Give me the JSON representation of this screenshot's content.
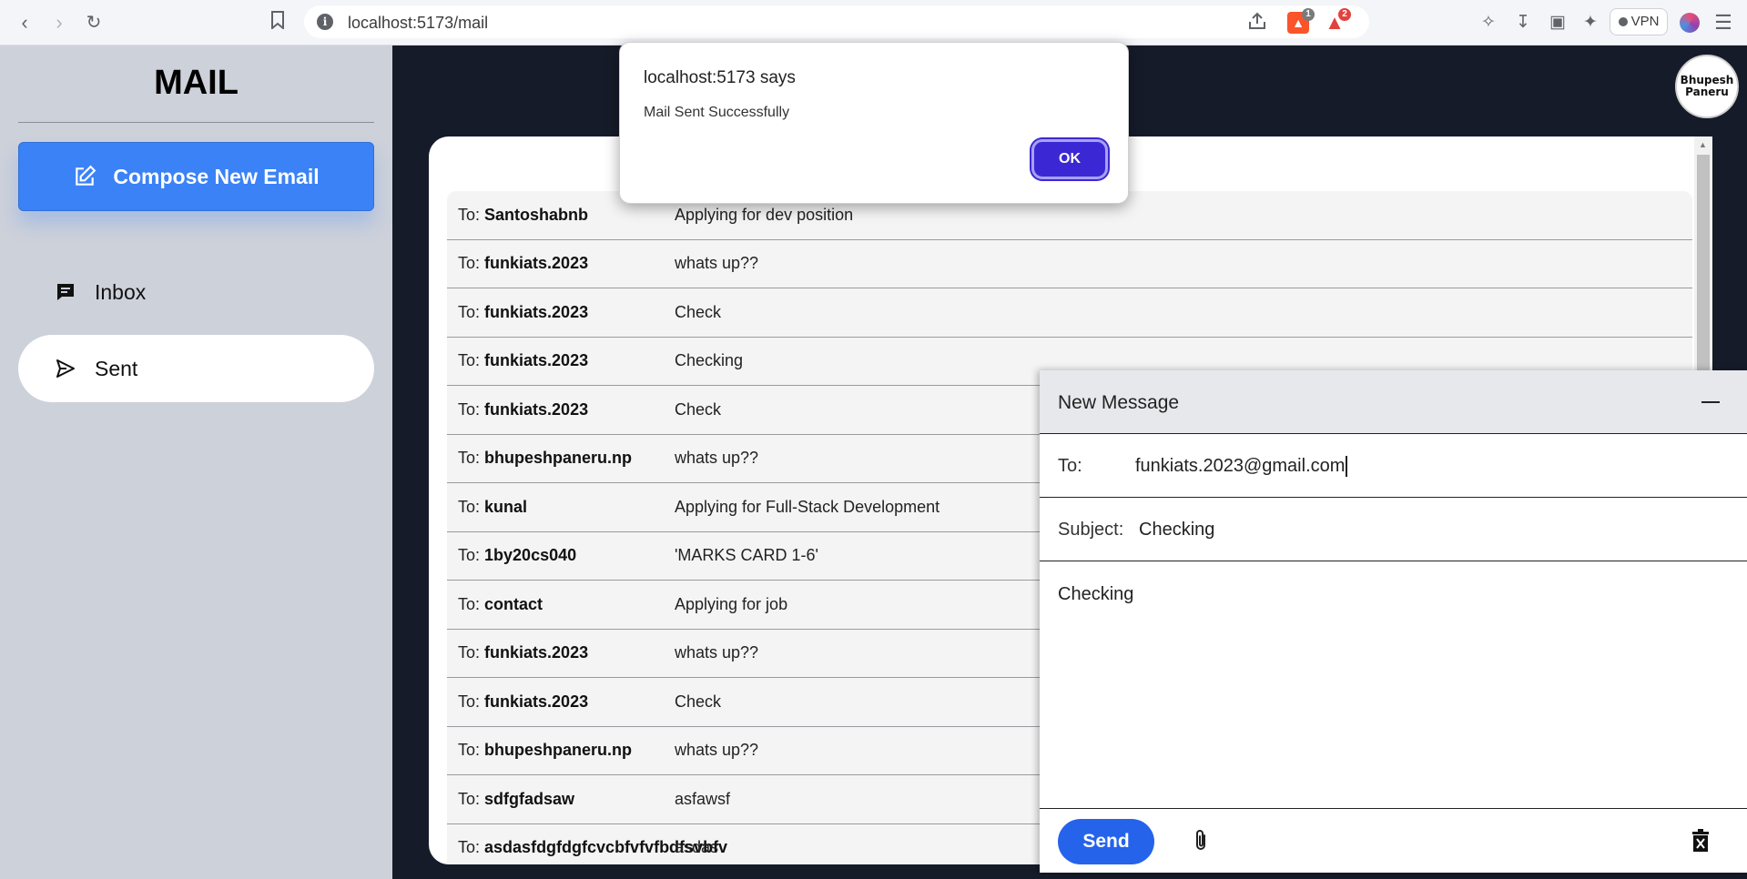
{
  "browser": {
    "url": "localhost:5173/mail",
    "vpn_label": "VPN",
    "shields_count": "1",
    "rewards_count": "2"
  },
  "sidebar": {
    "logo": "MAIL",
    "compose_label": "Compose New Email",
    "items": [
      {
        "label": "Inbox",
        "icon": "inbox-icon"
      },
      {
        "label": "Sent",
        "icon": "send-icon",
        "active": true
      }
    ]
  },
  "user": {
    "avatar_text_line1": "Bhupesh",
    "avatar_text_line2": "Paneru"
  },
  "mail_list": {
    "prefix": "To:",
    "rows": [
      {
        "to": "Santoshabnb",
        "subject": "Applying for dev position"
      },
      {
        "to": "funkiats.2023",
        "subject": "whats up??"
      },
      {
        "to": "funkiats.2023",
        "subject": "Check"
      },
      {
        "to": "funkiats.2023",
        "subject": "Checking"
      },
      {
        "to": "funkiats.2023",
        "subject": "Check"
      },
      {
        "to": "bhupeshpaneru.np",
        "subject": "whats up??"
      },
      {
        "to": "kunal",
        "subject": "Applying for Full-Stack Development"
      },
      {
        "to": "1by20cs040",
        "subject": "'MARKS CARD 1-6'"
      },
      {
        "to": "contact",
        "subject": "Applying for job"
      },
      {
        "to": "funkiats.2023",
        "subject": "whats up??"
      },
      {
        "to": "funkiats.2023",
        "subject": "Check"
      },
      {
        "to": "bhupeshpaneru.np",
        "subject": "whats up??"
      },
      {
        "to": "sdfgfadsaw",
        "subject": "asfawsf"
      },
      {
        "to": "asdasfdgfdgfcvcbfvfvfbdfsvbfv",
        "subject": "asdas"
      }
    ]
  },
  "compose_window": {
    "title": "New Message",
    "to_label": "To:",
    "to_value": "funkiats.2023@gmail.com",
    "subject_label": "Subject:",
    "subject_value": "Checking",
    "body": "Checking",
    "send_label": "Send"
  },
  "alert": {
    "title": "localhost:5173 says",
    "message": "Mail Sent Successfully",
    "ok_label": "OK"
  },
  "colors": {
    "accent": "#3b82f6",
    "send": "#2563eb",
    "ok": "#3b28d4",
    "sidebar_bg": "#cdd1da",
    "main_bg": "#161b29"
  }
}
